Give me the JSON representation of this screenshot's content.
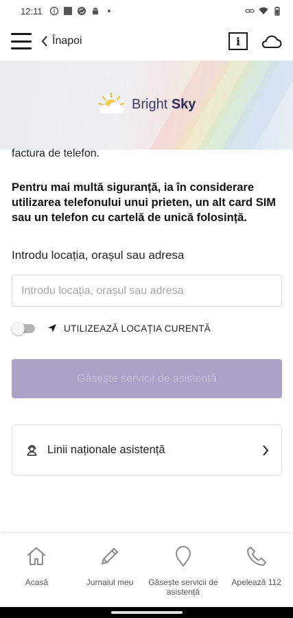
{
  "status_bar": {
    "time": "12:11"
  },
  "header": {
    "back_label": "Înapoi"
  },
  "banner": {
    "logo_bright": "Bright",
    "logo_sky": "Sky"
  },
  "content": {
    "cut_text": "factura de telefon.",
    "safety_paragraph": "Pentru mai multă siguranță, ia în considerare utilizarea telefonului unui prieten, un alt card SIM sau un telefon cu cartelă de unică folosință.",
    "location_label": "Introdu locația, orașul sau adresa",
    "location_input": {
      "value": "",
      "placeholder": "Introdu locația, orașul sau adresa"
    },
    "use_location_label": "UTILIZEAZĂ LOCAȚIA CURENTĂ",
    "use_location_enabled": false,
    "find_button_label": "Găsește servicii de asistență",
    "helplines_label": "Linii naționale asistență"
  },
  "bottom_nav": {
    "items": [
      {
        "label": "Acasă",
        "icon": "home-icon"
      },
      {
        "label": "Jurnalul meu",
        "icon": "pencil-icon"
      },
      {
        "label": "Găsește servicii de asistență",
        "icon": "map-pin-icon"
      },
      {
        "label": "Apelează 112",
        "icon": "phone-icon"
      }
    ]
  },
  "colors": {
    "accent_disabled": "#a9a2c6",
    "logo_text": "#2d2b5e"
  }
}
